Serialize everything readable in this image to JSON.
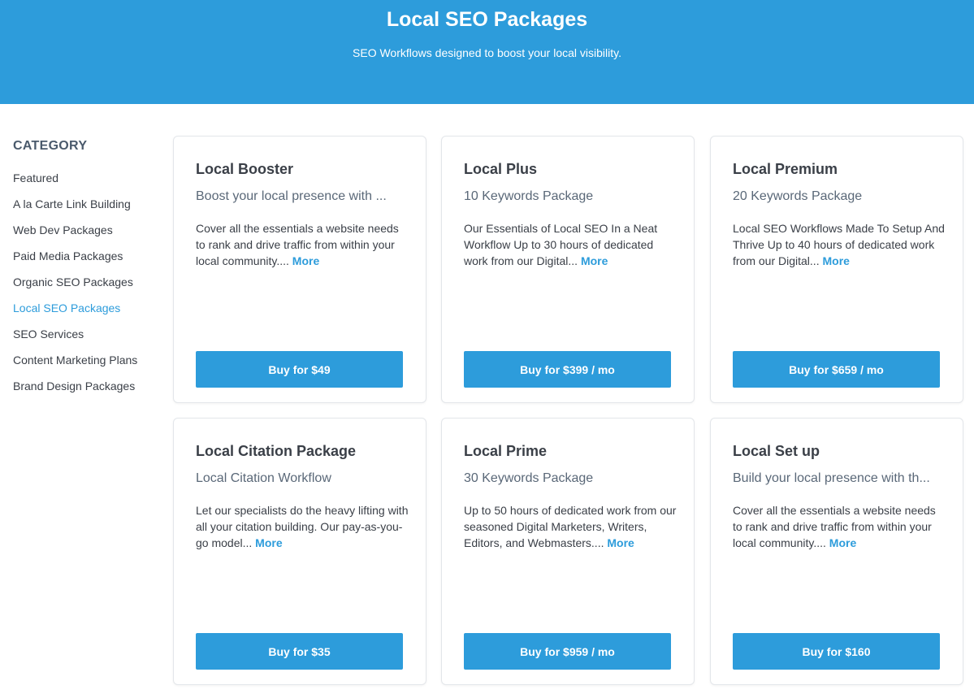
{
  "hero": {
    "title": "Local SEO Packages",
    "subtitle": "SEO Workflows designed to boost your local visibility."
  },
  "sidebar": {
    "heading": "CATEGORY",
    "items": [
      {
        "label": "Featured",
        "active": false
      },
      {
        "label": "A la Carte Link Building",
        "active": false
      },
      {
        "label": "Web Dev Packages",
        "active": false
      },
      {
        "label": "Paid Media Packages",
        "active": false
      },
      {
        "label": "Organic SEO Packages",
        "active": false
      },
      {
        "label": "Local SEO Packages",
        "active": true
      },
      {
        "label": "SEO Services",
        "active": false
      },
      {
        "label": "Content Marketing Plans",
        "active": false
      },
      {
        "label": "Brand Design Packages",
        "active": false
      }
    ]
  },
  "more_label": "More",
  "cards": [
    {
      "title": "Local Booster",
      "subtitle": "Boost your local presence with ...",
      "description": "Cover all the essentials a website needs to rank and drive traffic from within your local community.... ",
      "button": "Buy for $49"
    },
    {
      "title": "Local Plus",
      "subtitle": "10 Keywords Package",
      "description": "Our Essentials of Local SEO In a Neat Workflow Up to 30 hours of dedicated work from our Digital... ",
      "button": "Buy for $399 / mo"
    },
    {
      "title": "Local Premium",
      "subtitle": "20 Keywords Package",
      "description": "Local SEO Workflows Made To Setup And Thrive Up to 40 hours of dedicated work from our Digital... ",
      "button": "Buy for $659 / mo"
    },
    {
      "title": "Local Citation Package",
      "subtitle": "Local Citation Workflow",
      "description": "Let our specialists do the heavy lifting with all your citation building. Our pay-as-you-go model... ",
      "button": "Buy for $35"
    },
    {
      "title": "Local Prime",
      "subtitle": "30 Keywords Package",
      "description": "Up to 50 hours of dedicated work from our seasoned Digital Marketers, Writers, Editors, and Webmasters.... ",
      "button": "Buy for $959 / mo"
    },
    {
      "title": "Local Set up",
      "subtitle": "Build your local presence with th...",
      "description": "Cover all the essentials a website needs to rank and drive traffic from within your local community.... ",
      "button": "Buy for $160"
    }
  ],
  "colors": {
    "accent": "#2d9cdb",
    "text": "#3a3f47",
    "card_border": "#e3e6ea"
  }
}
